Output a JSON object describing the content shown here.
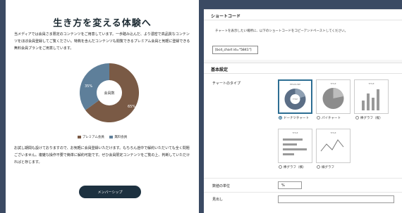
{
  "article": {
    "title": "生き方を変える体験へ",
    "intro": "当メディアでは会員さま限定のコンテンツをご用意しています。一歩踏み込んだ、より濃密で高品質なコンテンツをほぼ会員登録してご覧ください。特典を含んだコンテンツも閲覧できるプレミアム会員と気軽に登録できる無料会員プランをご用意しています。",
    "donut_center": "会員数",
    "chart_data": {
      "type": "pie",
      "categories": [
        "プレミアム会員",
        "無料会員"
      ],
      "values": [
        65,
        35
      ],
      "colors": [
        "#7a5a45",
        "#5e7f9a"
      ],
      "value_labels": [
        "65%",
        "35%"
      ]
    },
    "legend": [
      "プレミアム会員",
      "無料会員"
    ],
    "body": "お試し期間も設けておりますので、お気軽に会員登録いただけます。もちろん途中で解約いただいても全く問題ございません。複雑な操作不要で簡単に解約可能です。ぜひ会員限定コンテンツをご覧の上、判断していただければと存じます。",
    "button": "メンバーシップ"
  },
  "admin": {
    "shortcode_heading": "ショートコード",
    "shortcode_desc": "チャートを表示したい場所に、以下のショートコードをコピーアンドペーストしてください。",
    "shortcode_value": "[bcd_chart id=\"5841\"]",
    "basic_heading": "基本設定",
    "chart_type_label": "チャートのタイプ",
    "chart_types": [
      {
        "label": "ドーナツチャート",
        "selected": true
      },
      {
        "label": "パイチャート",
        "selected": false
      },
      {
        "label": "棒グラフ（縦）",
        "selected": false
      },
      {
        "label": "棒グラフ（横）",
        "selected": false
      },
      {
        "label": "線グラフ",
        "selected": false
      }
    ],
    "thumb_titles": {
      "donut_head": "HEADLINE",
      "donut_center": "TITLE",
      "pie": "TITLE",
      "vbar": "TITLE",
      "hbar": "TITLE",
      "line": "TITLE"
    },
    "unit_label": "数値の単位",
    "unit_value": "%",
    "heading_label": "見出し",
    "heading_value": ""
  }
}
